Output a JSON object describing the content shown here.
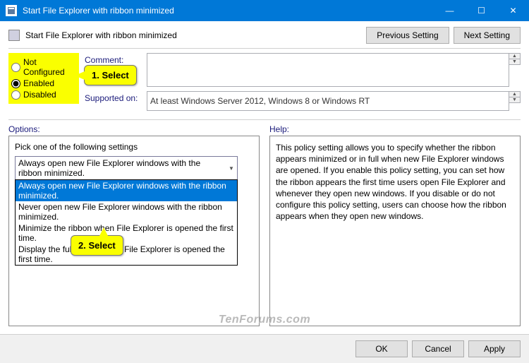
{
  "window": {
    "title": "Start File Explorer with ribbon minimized",
    "min": "—",
    "max": "☐",
    "close": "✕"
  },
  "header": {
    "policy_title": "Start File Explorer with ribbon minimized",
    "prev": "Previous Setting",
    "next": "Next Setting"
  },
  "radios": {
    "not_configured": "Not Configured",
    "enabled": "Enabled",
    "disabled": "Disabled"
  },
  "comment": {
    "label": "Comment:",
    "value": ""
  },
  "supported": {
    "label": "Supported on:",
    "value": "At least Windows Server 2012, Windows 8 or Windows RT"
  },
  "options": {
    "label": "Options:",
    "prompt": "Pick one of the following settings",
    "selected": "Always open new File Explorer windows with the ribbon minimized.",
    "items": [
      "Always open new File Explorer windows with the ribbon minimized.",
      "Never open new File Explorer windows with the ribbon minimized.",
      "Minimize the ribbon when File Explorer is opened the first time.",
      "Display the full ribbon when File Explorer is opened the first time."
    ]
  },
  "help": {
    "label": "Help:",
    "text": "This policy setting allows you to specify whether the ribbon appears minimized or in full when new File Explorer windows are opened. If you enable this policy setting, you can set how the ribbon appears the first time users open File Explorer and whenever they open new windows. If you disable or do not configure this policy setting, users can choose how the ribbon appears when they open new windows."
  },
  "footer": {
    "ok": "OK",
    "cancel": "Cancel",
    "apply": "Apply"
  },
  "callouts": {
    "c1": "1. Select",
    "c2": "2. Select"
  },
  "watermark": "TenForums.com"
}
